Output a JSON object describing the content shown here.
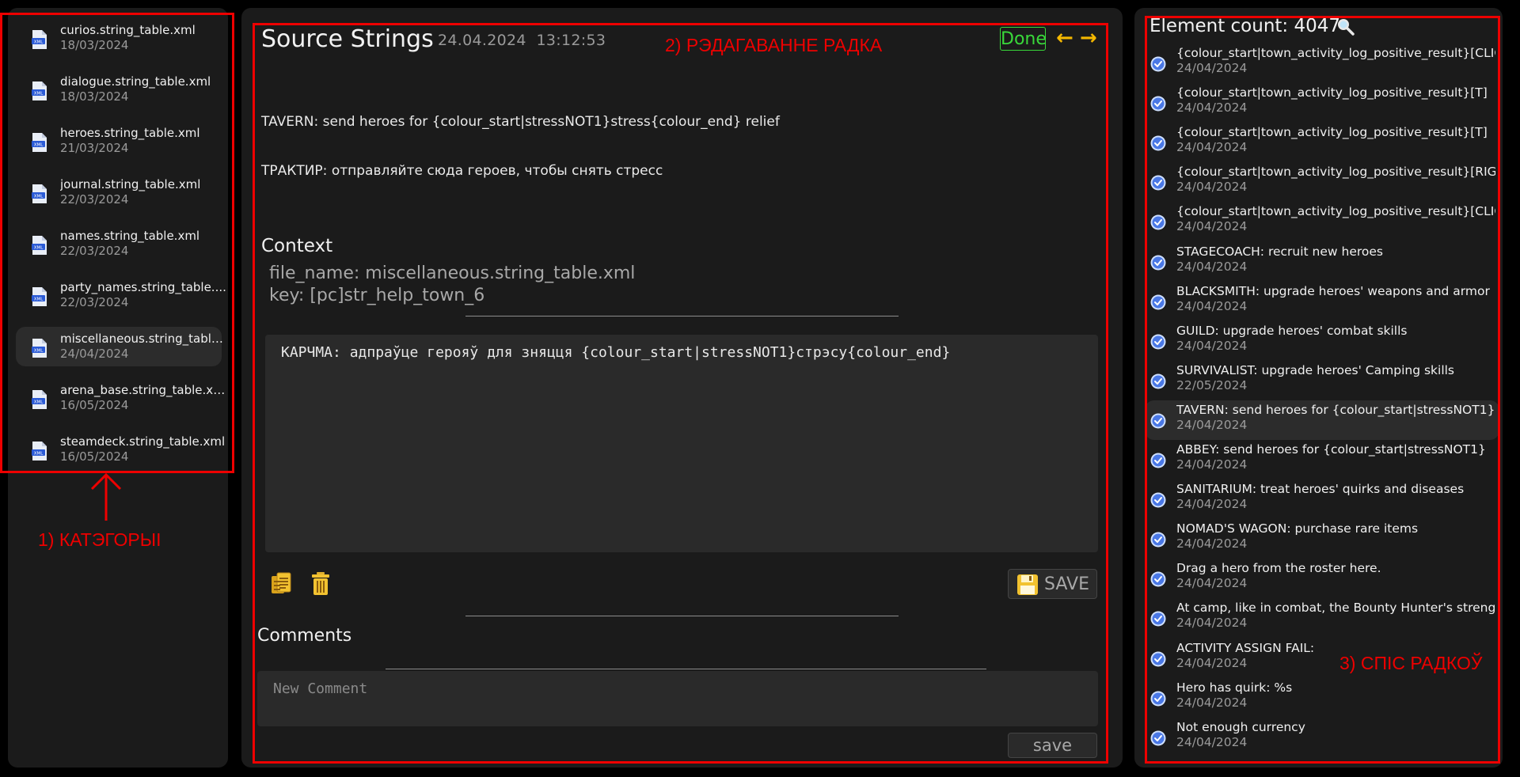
{
  "files": [
    {
      "name": "curios.string_table.xml",
      "date": "18/03/2024"
    },
    {
      "name": "dialogue.string_table.xml",
      "date": "18/03/2024"
    },
    {
      "name": "heroes.string_table.xml",
      "date": "21/03/2024"
    },
    {
      "name": "journal.string_table.xml",
      "date": "22/03/2024"
    },
    {
      "name": "names.string_table.xml",
      "date": "22/03/2024"
    },
    {
      "name": "party_names.string_table....",
      "date": "22/03/2024"
    },
    {
      "name": "miscellaneous.string_table...",
      "date": "24/04/2024",
      "active": true
    },
    {
      "name": "arena_base.string_table.xml",
      "date": "16/05/2024"
    },
    {
      "name": "steamdeck.string_table.xml",
      "date": "16/05/2024"
    }
  ],
  "file_icon": "xml-file-icon",
  "editor": {
    "title": "Source Strings",
    "date": "24.04.2024",
    "time": "13:12:53",
    "done_label": "Done",
    "prev_icon": "arrow-left-icon",
    "next_icon": "arrow-right-icon",
    "prev_glyph": "←",
    "next_glyph": "→",
    "source_text": "TAVERN: send heroes for {colour_start|stressNOT1}stress{colour_end} relief",
    "reference_text": "ТРАКТИР: отправляйте сюда героев, чтобы снять стресс",
    "context_title": "Context",
    "context_file": "file_name: miscellaneous.string_table.xml",
    "context_key": "key: [pc]str_help_town_6",
    "translation": "КАРЧМА: адпраўце герояў для зняцця {colour_start|stressNOT1}стрэсу{colour_end}",
    "copy_icon": "copy-icon",
    "delete_icon": "trash-icon",
    "save_label": "SAVE",
    "save_icon": "floppy-disk-icon",
    "comments_title": "Comments",
    "comment_placeholder": "New Comment",
    "comment_save_label": "save"
  },
  "list": {
    "count_label": "Element count: 4047",
    "search_icon": "search-icon",
    "check_icon": "check-circle-icon",
    "items": [
      {
        "text": "{colour_start|town_activity_log_positive_result}[CLICK]",
        "date": "24/04/2024"
      },
      {
        "text": "{colour_start|town_activity_log_positive_result}[T]",
        "date": "24/04/2024"
      },
      {
        "text": "{colour_start|town_activity_log_positive_result}[T]",
        "date": "24/04/2024"
      },
      {
        "text": "{colour_start|town_activity_log_positive_result}[RIGHT-",
        "date": "24/04/2024"
      },
      {
        "text": "{colour_start|town_activity_log_positive_result}[CLICK]",
        "date": "24/04/2024"
      },
      {
        "text": "STAGECOACH: recruit new heroes",
        "date": "24/04/2024"
      },
      {
        "text": "BLACKSMITH: upgrade heroes' weapons and armor",
        "date": "24/04/2024"
      },
      {
        "text": "GUILD: upgrade heroes' combat skills",
        "date": "24/04/2024"
      },
      {
        "text": "SURVIVALIST: upgrade heroes' Camping skills",
        "date": "22/05/2024"
      },
      {
        "text": "TAVERN: send heroes for {colour_start|stressNOT1}",
        "date": "24/04/2024",
        "active": true
      },
      {
        "text": "ABBEY: send heroes for {colour_start|stressNOT1}",
        "date": "24/04/2024"
      },
      {
        "text": "SANITARIUM: treat heroes' quirks and diseases",
        "date": "24/04/2024"
      },
      {
        "text": "NOMAD'S WAGON: purchase rare items",
        "date": "24/04/2024"
      },
      {
        "text": "Drag a hero from the roster here.",
        "date": "24/04/2024"
      },
      {
        "text": "At camp, like in combat, the Bounty Hunter's strength",
        "date": "24/04/2024"
      },
      {
        "text": "ACTIVITY ASSIGN FAIL:",
        "date": "24/04/2024"
      },
      {
        "text": "Hero has quirk: %s",
        "date": "24/04/2024"
      },
      {
        "text": "Not enough currency",
        "date": "24/04/2024"
      }
    ]
  },
  "annotations": {
    "categories": "1) КАТЭГОРЫІ",
    "row_editing": "2) РЭДАГАВАННЕ РАДКА",
    "row_list": "3) СПІС РАДКОЎ"
  },
  "colors": {
    "background": "#000000",
    "panel": "#1b1b1b",
    "annotation_red": "#ee0000",
    "done_green": "#39d83a",
    "arrow_yellow": "#f5b800",
    "check_blue": "#5b8def"
  }
}
